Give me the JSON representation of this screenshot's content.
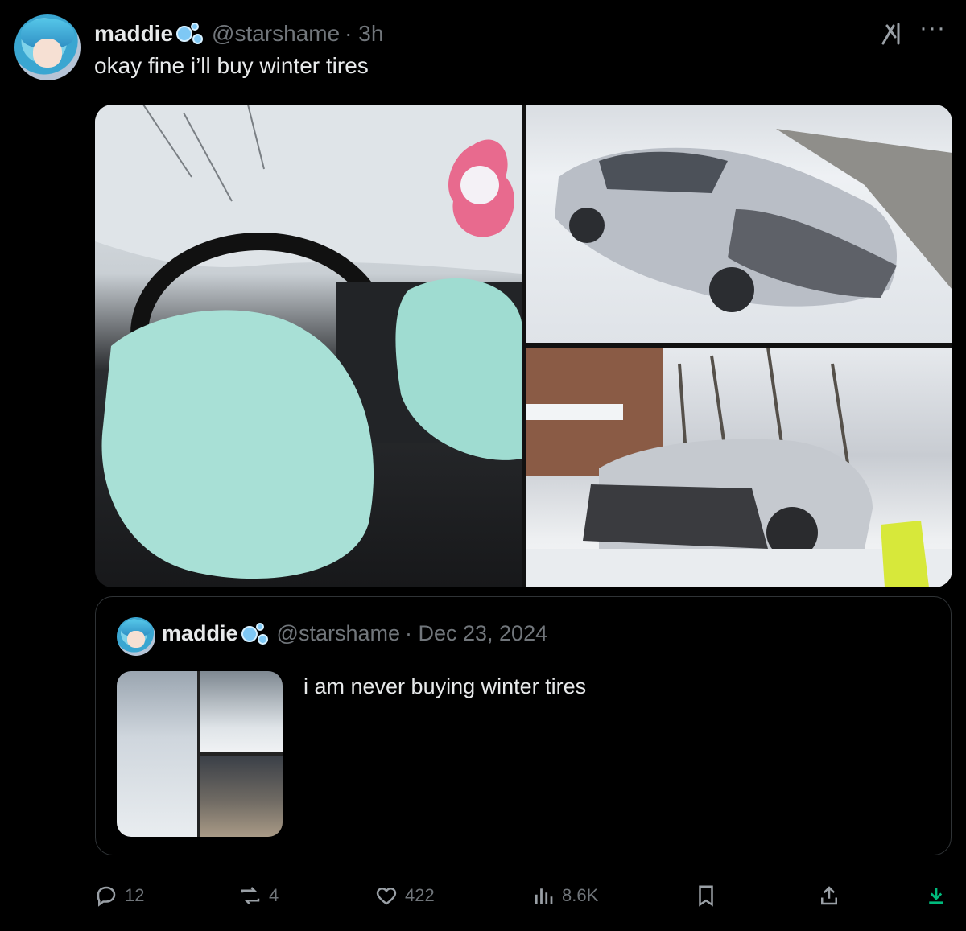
{
  "tweet": {
    "author_name": "maddie",
    "handle": "@starshame",
    "time": "· 3h",
    "text": "okay fine i’ll buy winter tires"
  },
  "quote": {
    "author_name": "maddie",
    "handle": "@starshame",
    "date": "· Dec 23, 2024",
    "text": "i am never buying winter tires"
  },
  "actions": {
    "replies": "12",
    "reposts": "4",
    "likes": "422",
    "views": "8.6K"
  },
  "icons": {
    "grok": "grok-icon",
    "more": "more-icon",
    "reply": "reply-icon",
    "repost": "repost-icon",
    "like": "heart-icon",
    "views": "views-icon",
    "bookmark": "bookmark-icon",
    "share": "share-icon",
    "download": "download-icon"
  },
  "colors": {
    "background": "#000000",
    "text": "#e7e9ea",
    "secondary": "#71767b",
    "border": "#2f3336",
    "download_accent": "#00ba7c"
  }
}
